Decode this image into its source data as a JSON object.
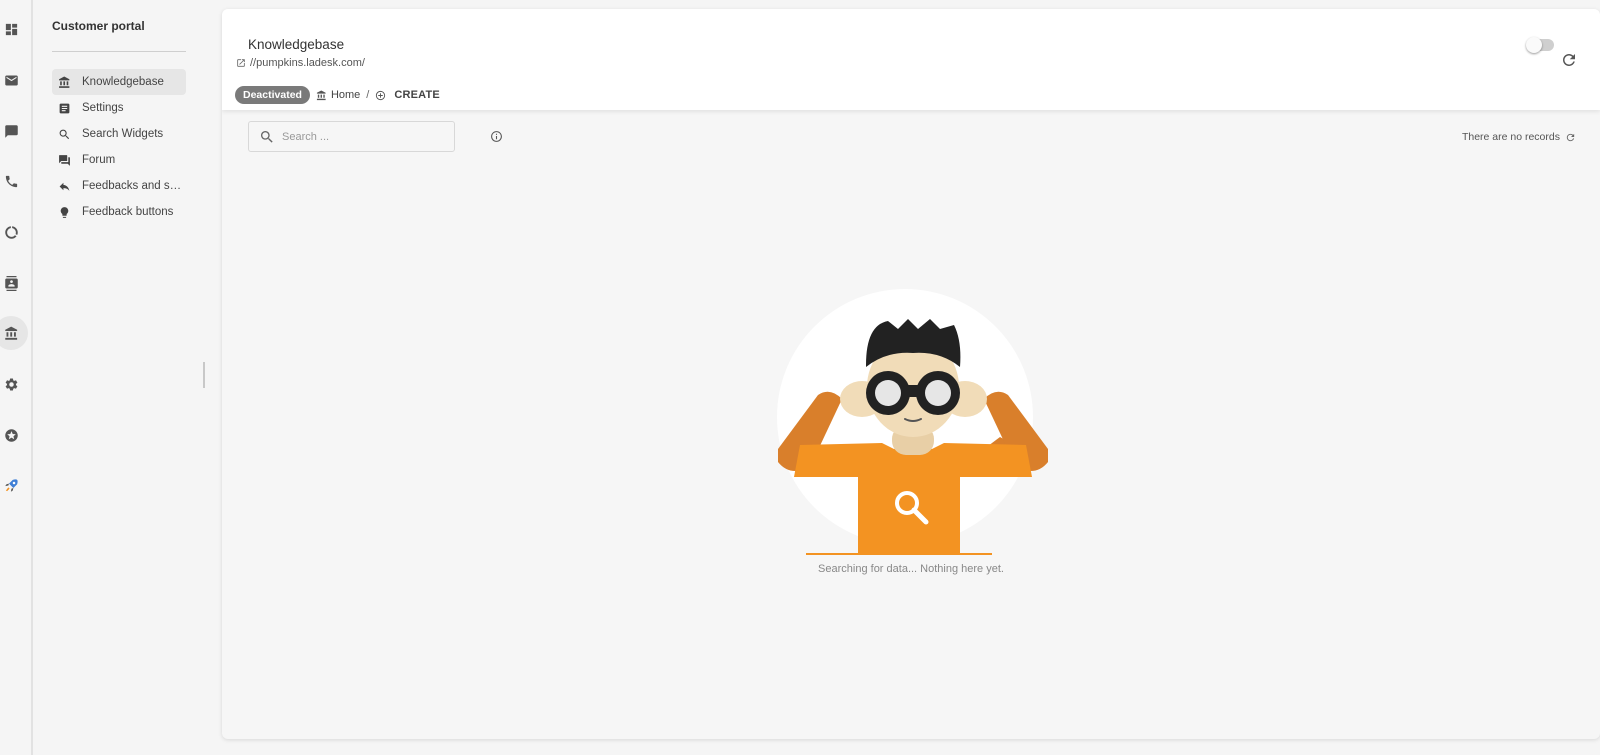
{
  "rail": {
    "items": [
      {
        "icon": "dashboard-icon"
      },
      {
        "icon": "mail-icon"
      },
      {
        "icon": "chat-icon"
      },
      {
        "icon": "phone-icon"
      },
      {
        "icon": "reports-icon"
      },
      {
        "icon": "contacts-icon"
      },
      {
        "icon": "knowledgebase-icon",
        "active": true
      },
      {
        "icon": "gear-icon"
      },
      {
        "icon": "star-icon"
      },
      {
        "icon": "rocket-icon"
      }
    ]
  },
  "subnav": {
    "title": "Customer portal",
    "items": [
      {
        "label": "Knowledgebase",
        "icon": "knowledgebase-icon",
        "active": true
      },
      {
        "label": "Settings",
        "icon": "settings-list-icon"
      },
      {
        "label": "Search Widgets",
        "icon": "search-icon"
      },
      {
        "label": "Forum",
        "icon": "forum-icon"
      },
      {
        "label": "Feedbacks and suggestions",
        "icon": "reply-icon"
      },
      {
        "label": "Feedback buttons",
        "icon": "lightbulb-icon"
      }
    ]
  },
  "header": {
    "title": "Knowledgebase",
    "url": "//pumpkins.ladesk.com/",
    "status_badge": "Deactivated",
    "breadcrumb_home": "Home",
    "breadcrumb_separator": "/",
    "create_label": "CREATE",
    "toggle_on": false
  },
  "toolbar": {
    "search_placeholder": "Search ...",
    "records_text": "There are no records"
  },
  "empty_state": {
    "message": "Searching for data... Nothing here yet."
  },
  "colors": {
    "accent_orange": "#f39322",
    "dark_orange": "#d97f2b",
    "badge_gray": "#7a7a7a"
  }
}
